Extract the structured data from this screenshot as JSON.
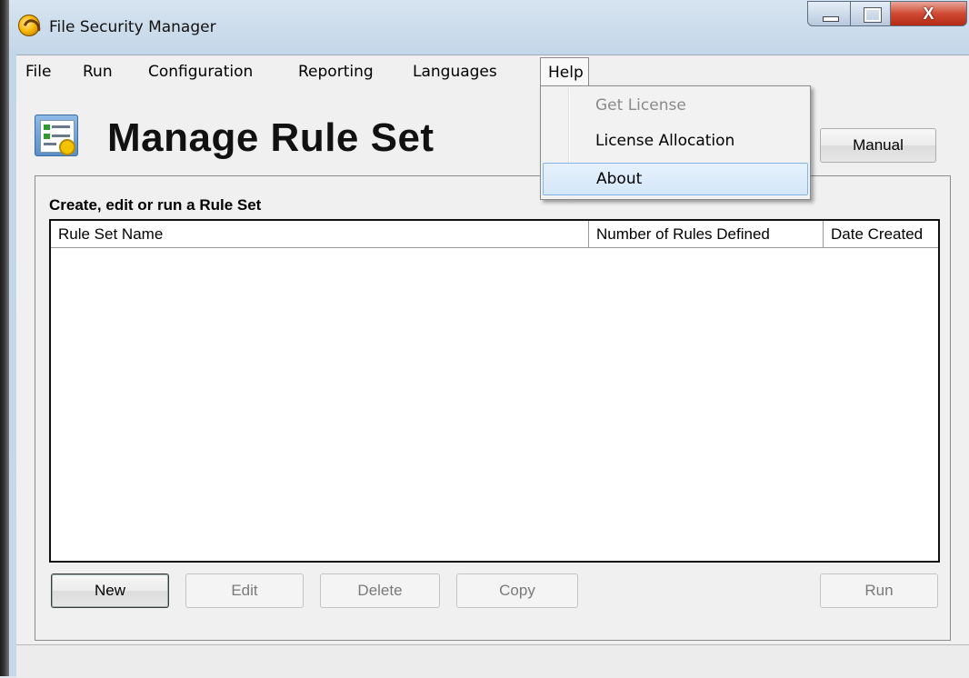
{
  "window": {
    "title": "File Security Manager",
    "close_glyph": "X"
  },
  "menubar": {
    "items": [
      {
        "label": "File"
      },
      {
        "label": "Run"
      },
      {
        "label": "Configuration"
      },
      {
        "label": "Reporting"
      },
      {
        "label": "Languages"
      },
      {
        "label": "Help"
      }
    ]
  },
  "help_menu": {
    "items": [
      {
        "label": "Get License",
        "enabled": false
      },
      {
        "label": "License Allocation",
        "enabled": true
      },
      {
        "label": "About",
        "enabled": true,
        "highlighted": true
      }
    ]
  },
  "header": {
    "title": "Manage Rule Set",
    "manual_label": "Manual"
  },
  "group": {
    "title": "Create, edit or run a Rule Set",
    "columns": [
      {
        "label": "Rule Set Name"
      },
      {
        "label": "Number of Rules Defined"
      },
      {
        "label": "Date Created"
      }
    ],
    "rows": []
  },
  "buttons": {
    "new_label": "New",
    "edit_label": "Edit",
    "delete_label": "Delete",
    "copy_label": "Copy",
    "run_label": "Run"
  },
  "colors": {
    "menu_highlight": "#d4e7fa",
    "menu_highlight_border": "#7eb4ea",
    "close_button": "#cf4a33"
  }
}
